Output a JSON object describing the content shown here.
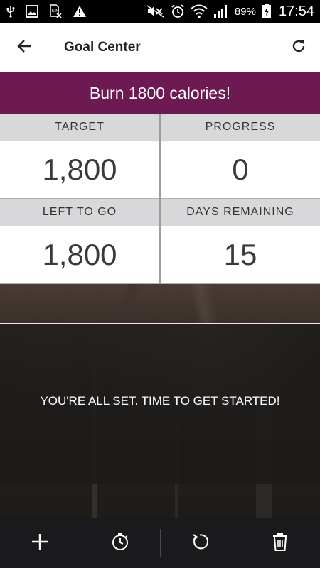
{
  "status_bar": {
    "battery_percent": "89%",
    "time": "17:54",
    "icons": [
      "usb-icon",
      "image-icon",
      "sim-disabled-icon",
      "warning-icon",
      "mute-icon",
      "alarm-icon",
      "wifi-icon",
      "signal-icon",
      "battery-charging-icon"
    ]
  },
  "app_bar": {
    "title": "Goal Center",
    "back_icon": "arrow-back-icon",
    "refresh_icon": "refresh-icon"
  },
  "goal": {
    "title": "Burn 1800 calories!",
    "banner_color": "#6d1a52"
  },
  "stats": {
    "target_label": "TARGET",
    "target_value": "1,800",
    "progress_label": "PROGRESS",
    "progress_value": "0",
    "left_label": "LEFT TO GO",
    "left_value": "1,800",
    "days_label": "DAYS REMAINING",
    "days_value": "15"
  },
  "message": "YOU'RE ALL SET. TIME TO GET STARTED!",
  "toolbar": {
    "icons": [
      "add-icon",
      "timer-icon",
      "reset-icon",
      "trash-icon"
    ]
  }
}
